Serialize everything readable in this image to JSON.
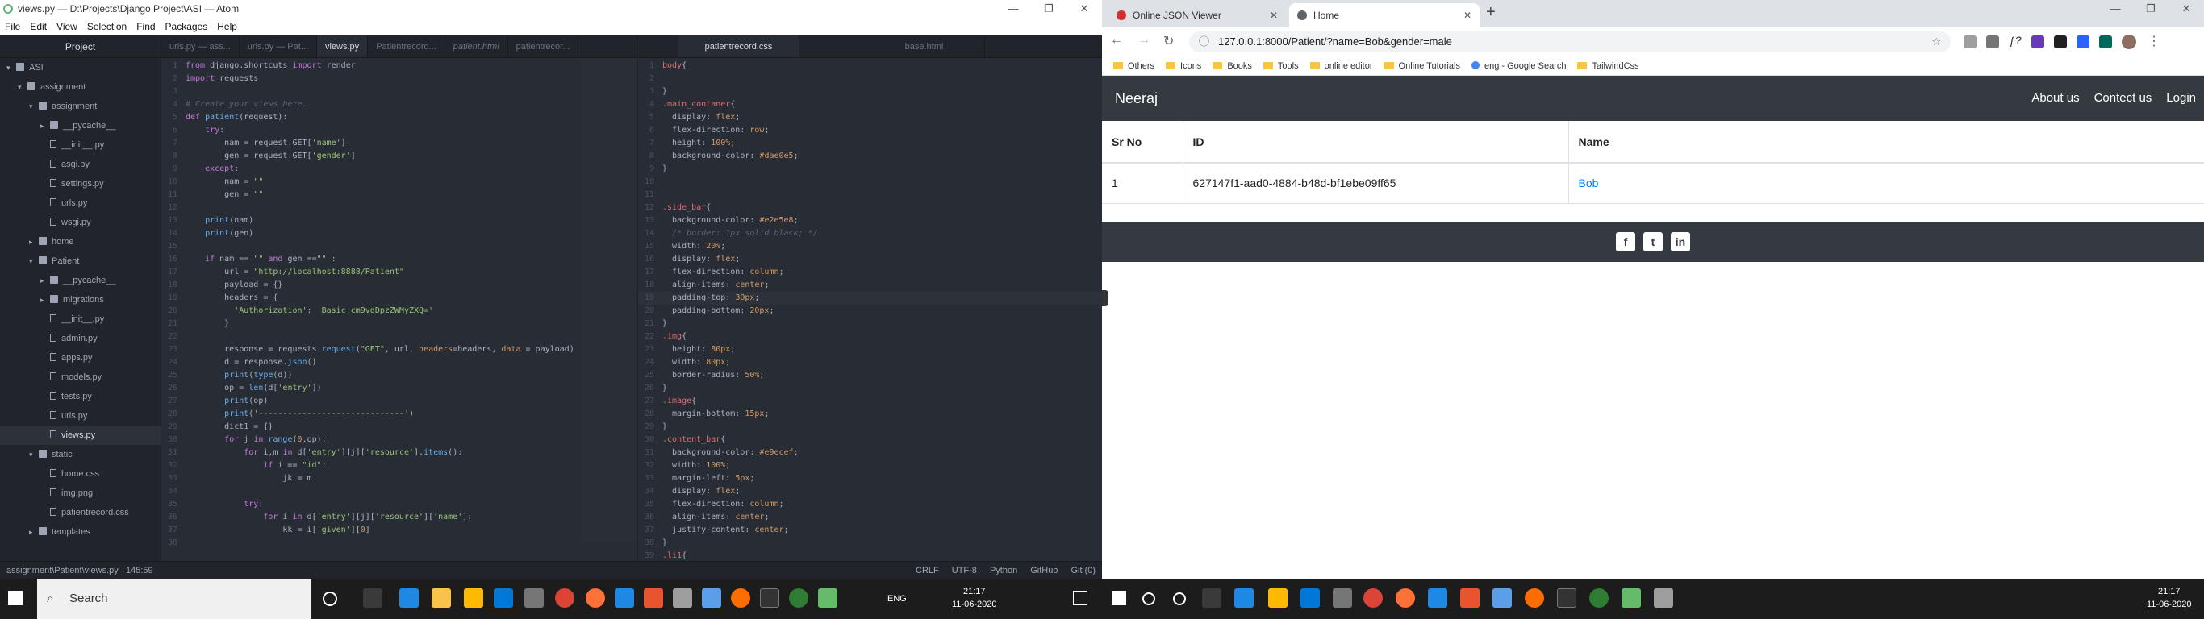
{
  "atom": {
    "title": "views.py — D:\\Projects\\Django Project\\ASI — Atom",
    "menu": [
      "File",
      "Edit",
      "View",
      "Selection",
      "Find",
      "Packages",
      "Help"
    ],
    "tree_title": "Project",
    "tree": [
      {
        "label": "ASI",
        "depth": 0,
        "type": "folder",
        "open": true
      },
      {
        "label": "assignment",
        "depth": 1,
        "type": "folder",
        "open": true
      },
      {
        "label": "assignment",
        "depth": 2,
        "type": "folder",
        "open": true
      },
      {
        "label": "__pycache__",
        "depth": 3,
        "type": "folder",
        "open": false
      },
      {
        "label": "__init__.py",
        "depth": 3,
        "type": "file"
      },
      {
        "label": "asgi.py",
        "depth": 3,
        "type": "file"
      },
      {
        "label": "settings.py",
        "depth": 3,
        "type": "file"
      },
      {
        "label": "urls.py",
        "depth": 3,
        "type": "file"
      },
      {
        "label": "wsgi.py",
        "depth": 3,
        "type": "file"
      },
      {
        "label": "home",
        "depth": 2,
        "type": "folder",
        "open": false
      },
      {
        "label": "Patient",
        "depth": 2,
        "type": "folder",
        "open": true
      },
      {
        "label": "__pycache__",
        "depth": 3,
        "type": "folder",
        "open": false
      },
      {
        "label": "migrations",
        "depth": 3,
        "type": "folder",
        "open": false
      },
      {
        "label": "__init__.py",
        "depth": 3,
        "type": "file"
      },
      {
        "label": "admin.py",
        "depth": 3,
        "type": "file"
      },
      {
        "label": "apps.py",
        "depth": 3,
        "type": "file"
      },
      {
        "label": "models.py",
        "depth": 3,
        "type": "file"
      },
      {
        "label": "tests.py",
        "depth": 3,
        "type": "file"
      },
      {
        "label": "urls.py",
        "depth": 3,
        "type": "file"
      },
      {
        "label": "views.py",
        "depth": 3,
        "type": "file",
        "selected": true
      },
      {
        "label": "static",
        "depth": 2,
        "type": "folder",
        "open": true
      },
      {
        "label": "home.css",
        "depth": 3,
        "type": "file"
      },
      {
        "label": "img.png",
        "depth": 3,
        "type": "file"
      },
      {
        "label": "patientrecord.css",
        "depth": 3,
        "type": "file"
      },
      {
        "label": "templates",
        "depth": 2,
        "type": "folder",
        "open": false
      }
    ],
    "pane1_tabs": [
      {
        "label": "urls.py — ass...",
        "active": false,
        "italic": false
      },
      {
        "label": "urls.py — Pat...",
        "active": false,
        "italic": false
      },
      {
        "label": "views.py",
        "active": true,
        "italic": false
      },
      {
        "label": "Patientrecord...",
        "active": false,
        "italic": false
      },
      {
        "label": "patient.html",
        "active": false,
        "italic": true
      },
      {
        "label": "patientrecor...",
        "active": false,
        "italic": false
      }
    ],
    "pane2_tabs": [
      {
        "label": "patientrecord.css",
        "active": true,
        "italic": false
      },
      {
        "label": "base.html",
        "active": false,
        "italic": false
      }
    ],
    "status": {
      "path": "assignment\\Patient\\views.py",
      "cursor": "145:59",
      "items": [
        "CRLF",
        "UTF-8",
        "Python",
        "GitHub",
        "Git (0)"
      ]
    }
  },
  "chrome": {
    "tabs": [
      {
        "label": "Online JSON Viewer",
        "active": false
      },
      {
        "label": "Home",
        "active": true
      }
    ],
    "url": "127.0.0.1:8000/Patient/?name=Bob&gender=male",
    "bookmarks": [
      "Others",
      "Icons",
      "Books",
      "Tools",
      "online editor",
      "Online Tutorials",
      "eng - Google Search",
      "TailwindCss"
    ]
  },
  "site": {
    "brand": "Neeraj",
    "nav": [
      "About us",
      "Contect us",
      "Login"
    ],
    "headers": [
      "Sr No",
      "ID",
      "Name"
    ],
    "rows": [
      {
        "sr": "1",
        "id": "627147f1-aad0-4884-b48d-bf1ebe09ff65",
        "name": "Bob"
      }
    ],
    "social": [
      "facebook-icon",
      "twitter-icon",
      "linkedin-icon"
    ]
  },
  "taskbar": {
    "search": "Search",
    "lang": "ENG",
    "time": "21:17",
    "date": "11-06-2020"
  },
  "colors": {
    "atom_bg": "#282c34",
    "navbar": "#343a40",
    "link": "#007bff"
  }
}
